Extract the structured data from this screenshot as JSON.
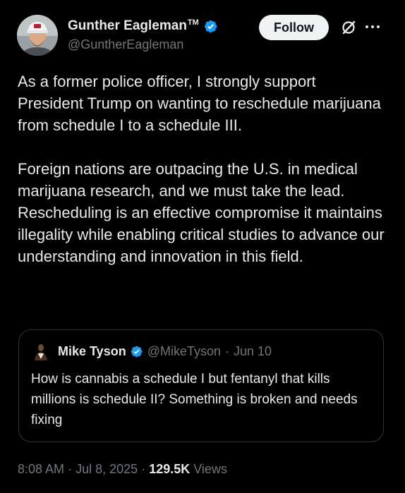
{
  "author": {
    "name": "Gunther Eagleman",
    "trademark": "TM",
    "handle": "@GuntherEagleman",
    "verified": true
  },
  "follow_label": "Follow",
  "icons": {
    "grok": "grok-icon",
    "more": "more-icon",
    "verified": "verified-badge-icon"
  },
  "body": {
    "paragraph1": "As a former police officer, I strongly support President Trump on wanting to reschedule marijuana from schedule I to a schedule III.",
    "paragraph2": "Foreign nations are outpacing the U.S. in medical marijuana research, and we must take the lead. Rescheduling is an effective compromise it maintains illegality while enabling critical studies to advance our understanding and innovation in this field."
  },
  "quote": {
    "name": "Mike Tyson",
    "handle": "@MikeTyson",
    "separator": "·",
    "date": "Jun 10",
    "text": "How is cannabis a schedule I but fentanyl that kills millions is schedule II? Something is broken and needs fixing"
  },
  "footer": {
    "time": "8:08 AM",
    "separator": "·",
    "date": "Jul 8, 2025",
    "views_count": "129.5K",
    "views_label": "Views"
  },
  "colors": {
    "background": "#000000",
    "text": "#e7e9ea",
    "muted": "#71767b",
    "verified": "#1d9bf0",
    "border": "#2f3336",
    "follow_bg": "#eff3f4"
  }
}
